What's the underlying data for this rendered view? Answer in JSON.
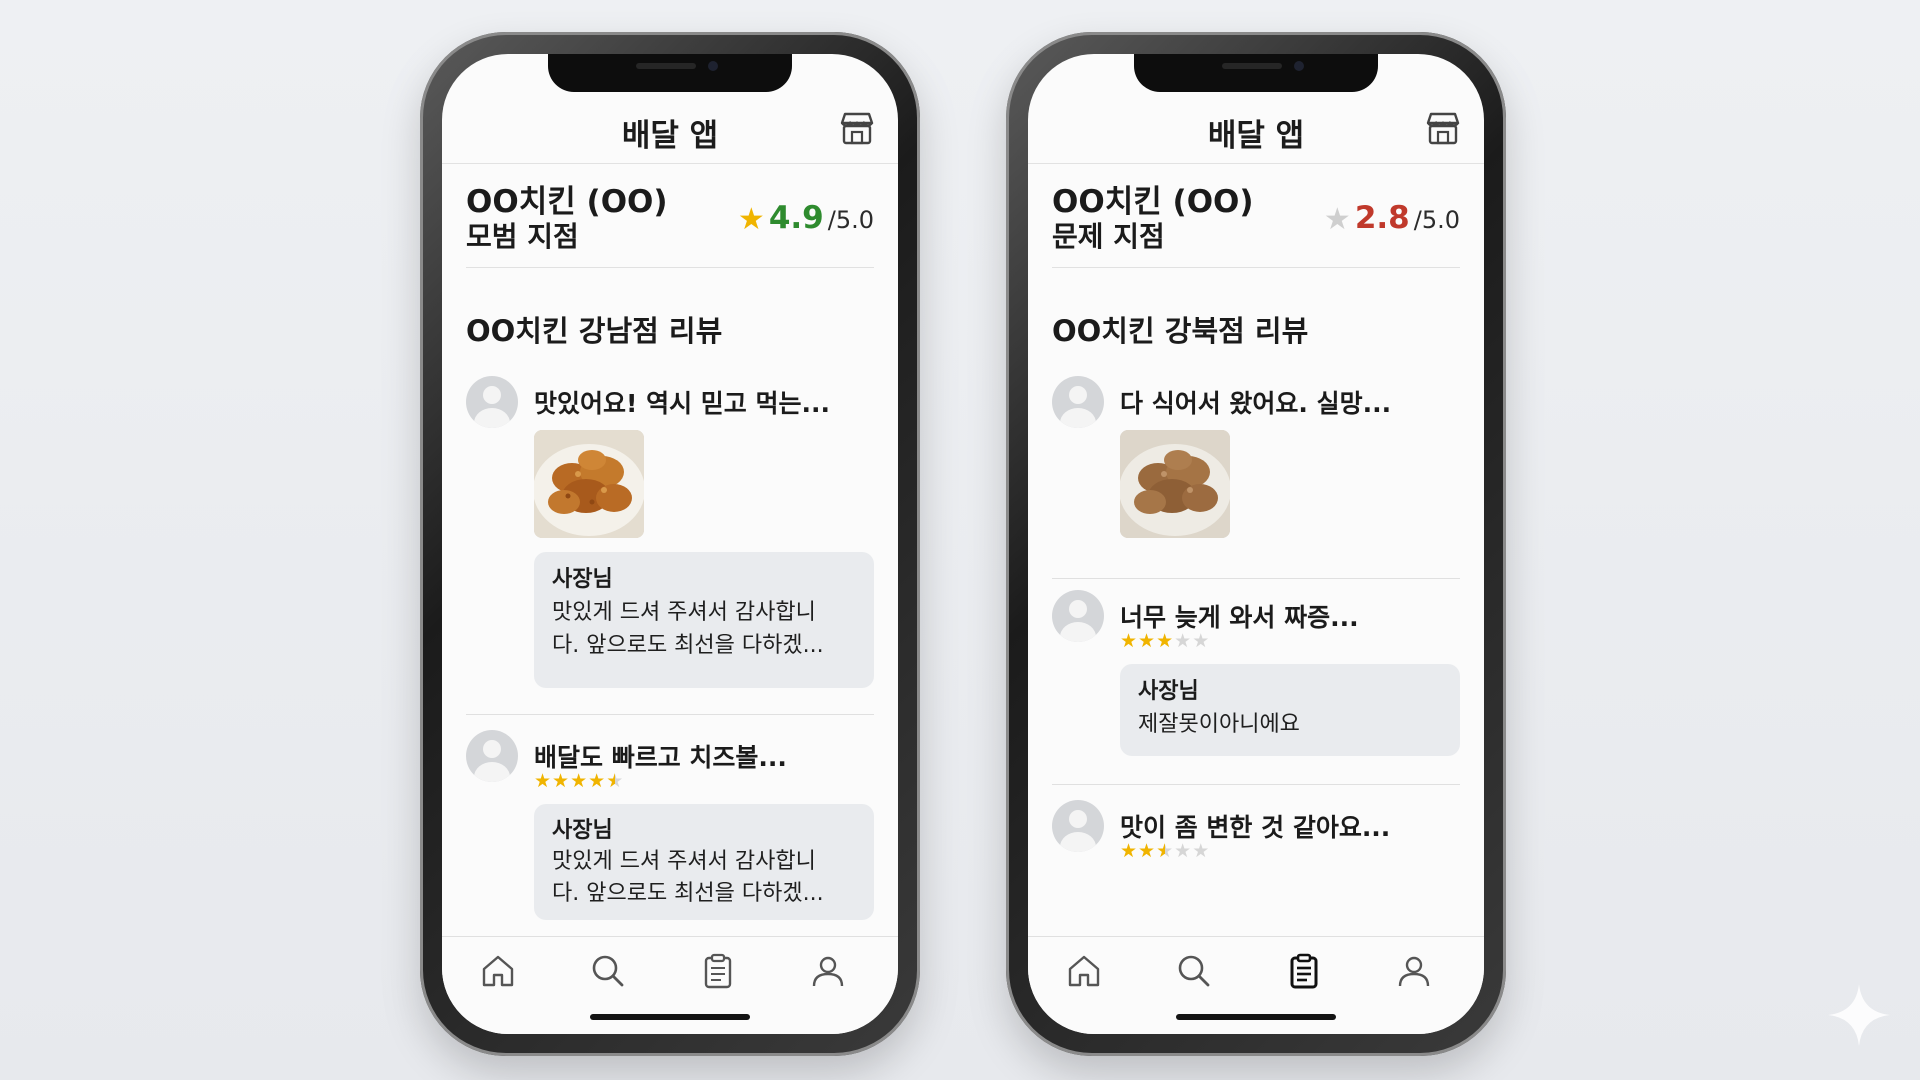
{
  "colors": {
    "good": "#2e8b2e",
    "bad": "#c0392b",
    "star_on": "#f0b400",
    "star_off": "#cfcfcf"
  },
  "phones": [
    {
      "header": {
        "title": "배달 앱",
        "store_icon": "store-icon"
      },
      "store": {
        "name": "OO치킨 (OO)",
        "branch": "모범 지점",
        "rating_value": "4.9",
        "rating_max": "/5.0",
        "rating_star": "★"
      },
      "section_title": "OO치킨 강남점 리뷰",
      "reviews": [
        {
          "text": "맛있어요! 역시 믿고 먹는...",
          "reply": {
            "author": "사장님",
            "text_line1": "맛있게 드셔 주셔서 감사합니",
            "text_line2": "다. 앞으로도 최선을 다하겠..."
          }
        },
        {
          "text": "배달도 빠르고 치즈볼...",
          "stars": 4.5,
          "reply": {
            "author": "사장님",
            "text_line1": "맛있게 드셔 주셔서 감사합니",
            "text_line2": "다. 앞으로도 최선을 다하겠..."
          }
        }
      ],
      "tabs": [
        "home-icon",
        "search-icon",
        "orders-icon",
        "profile-icon"
      ],
      "active_tab": "none"
    },
    {
      "header": {
        "title": "배달 앱",
        "store_icon": "store-icon"
      },
      "store": {
        "name": "OO치킨 (OO)",
        "branch": "문제 지점",
        "rating_value": "2.8",
        "rating_max": "/5.0",
        "rating_star": "★"
      },
      "section_title": "OO치킨 강북점 리뷰",
      "reviews": [
        {
          "text": "다 식어서 왔어요. 실망..."
        },
        {
          "text": "너무 늦게 와서 짜증...",
          "stars": 3,
          "reply": {
            "author": "사장님",
            "text": "제잘못이아니에요"
          }
        },
        {
          "text": "맛이 좀 변한 것 같아요...",
          "stars": 2.5
        }
      ],
      "tabs": [
        "home-icon",
        "search-icon",
        "orders-icon",
        "profile-icon"
      ],
      "active_tab": "orders-icon"
    }
  ]
}
